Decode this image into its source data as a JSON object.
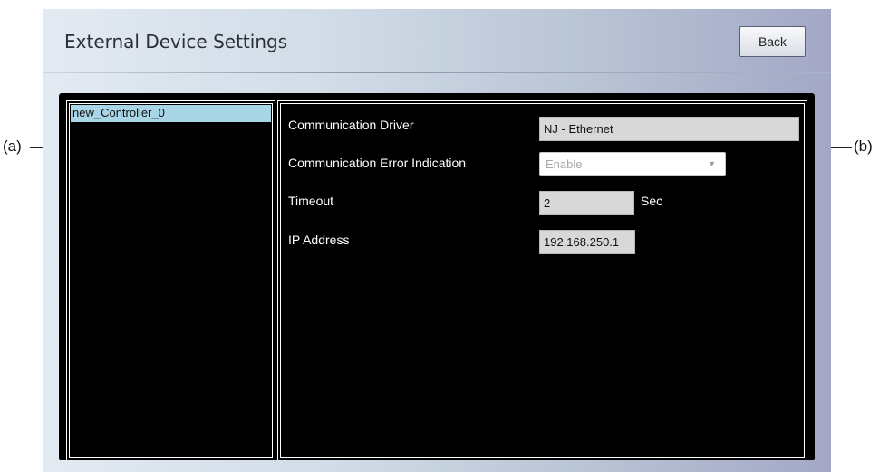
{
  "window": {
    "title": "External Device Settings",
    "back_label": "Back"
  },
  "device_list": {
    "items": [
      {
        "label": "new_Controller_0",
        "selected": true
      }
    ]
  },
  "settings": {
    "communication_driver": {
      "label": "Communication Driver",
      "value": "NJ - Ethernet"
    },
    "error_indication": {
      "label": "Communication Error Indication",
      "value": "Enable"
    },
    "timeout": {
      "label": "Timeout",
      "value": "2",
      "unit": "Sec"
    },
    "ip_address": {
      "label": "IP Address",
      "value": "192.168.250.1"
    }
  },
  "callouts": {
    "a": "(a)",
    "b": "(b)"
  },
  "colors": {
    "selection": "#a9d6e6",
    "panel": "#000000",
    "field": "#d8d8d8"
  }
}
